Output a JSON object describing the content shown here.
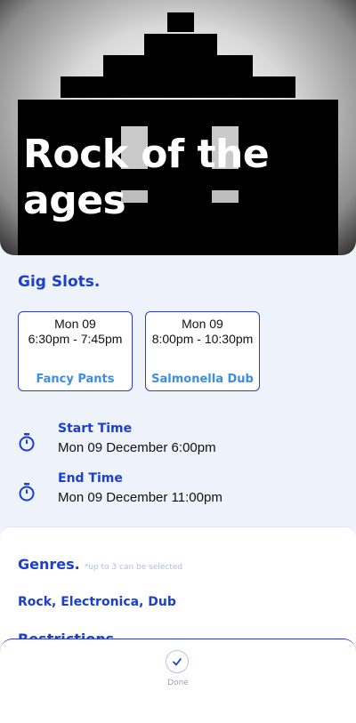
{
  "hero": {
    "title": "Rock of the ages"
  },
  "gig_slots": {
    "title": "Gig Slots.",
    "slots": [
      {
        "day": "Mon 09",
        "time": "6:30pm - 7:45pm",
        "act": "Fancy Pants"
      },
      {
        "day": "Mon 09",
        "time": "8:00pm - 10:30pm",
        "act": "Salmonella Dub"
      }
    ]
  },
  "times": {
    "start": {
      "label": "Start Time",
      "value": "Mon 09 December 6:00pm",
      "icon": "stopwatch-icon"
    },
    "end": {
      "label": "End Time",
      "value": "Mon 09 December 11:00pm",
      "icon": "stopwatch-icon"
    }
  },
  "genres": {
    "title": "Genres.",
    "hint": "*up to 3 can be selected",
    "value": "Rock, Electronica, Dub"
  },
  "restrictions": {
    "title": "Restrictions"
  },
  "bottom_sheet": {
    "done_label": "Done",
    "icon": "check-icon"
  },
  "colors": {
    "accent": "#1a3fd1",
    "act": "#3a8ee6",
    "background": "#eef2fa"
  }
}
